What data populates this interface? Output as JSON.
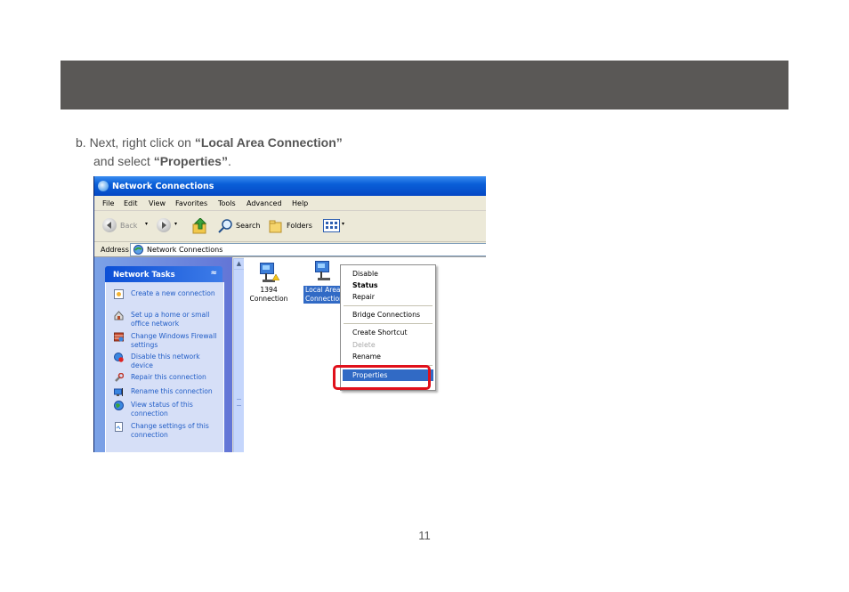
{
  "instruction": {
    "prefix": "b. Next, right click on ",
    "target": "“Local Area Connection”",
    "line2_prefix": "and select ",
    "action": "“Properties”",
    "suffix": "."
  },
  "window": {
    "title": "Network Connections",
    "menu": [
      "File",
      "Edit",
      "View",
      "Favorites",
      "Tools",
      "Advanced",
      "Help"
    ],
    "toolbar": {
      "back": "Back",
      "search": "Search",
      "folders": "Folders"
    },
    "address_label": "Address",
    "address_value": "Network Connections"
  },
  "tasks": {
    "header": "Network Tasks",
    "collapse_glyph": "≈",
    "items": [
      "Create a new connection",
      "Set up a home or small office network",
      "Change Windows Firewall settings",
      "Disable this network device",
      "Repair this connection",
      "Rename this connection",
      "View status of this connection",
      "Change settings of this connection"
    ]
  },
  "connections": [
    {
      "label1": "1394",
      "label2": "Connection"
    },
    {
      "label1": "Local Area",
      "label2": "Connection"
    }
  ],
  "context_menu": {
    "items": [
      "Disable",
      "Status",
      "Repair",
      "Bridge Connections",
      "Create Shortcut",
      "Delete",
      "Rename",
      "Properties"
    ],
    "bold_item": "Status",
    "disabled_item": "Delete",
    "selected_item": "Properties"
  },
  "page_number": "11",
  "colors": {
    "highlight": "#e0101b",
    "header_bar": "#5a5856",
    "selection": "#316ac5"
  }
}
